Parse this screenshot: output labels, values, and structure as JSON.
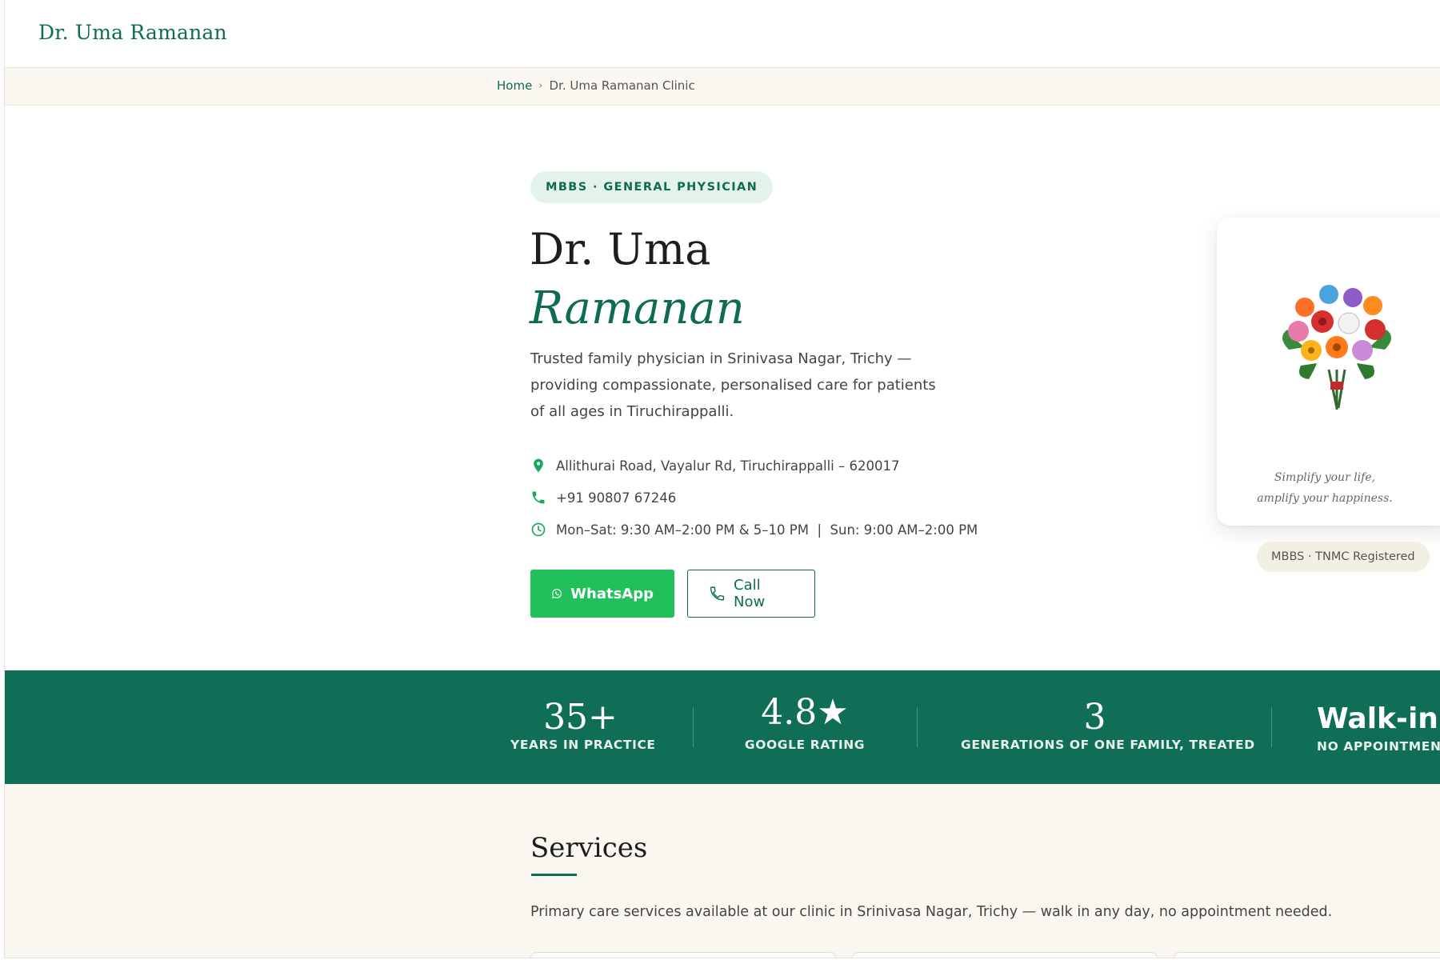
{
  "header": {
    "brand": "Dr. Uma Ramanan"
  },
  "breadcrumb": {
    "home": "Home",
    "separator": "›",
    "current": "Dr. Uma Ramanan Clinic"
  },
  "hero": {
    "badge": "MBBS · GENERAL PHYSICIAN",
    "name_line1": "Dr. Uma",
    "name_line2": "Ramanan",
    "intro": "Trusted family physician in Srinivasa Nagar, Trichy — providing compassionate, personalised care for patients of all ages in Tiruchirappalli.",
    "contacts": {
      "address": {
        "icon": "map-pin-icon",
        "text": "Allithurai Road, Vayalur Rd, Tiruchirappalli – 620017"
      },
      "phone": {
        "icon": "phone-icon",
        "text": "+91 90807 67246"
      },
      "hours": {
        "icon": "clock-icon",
        "text": "Mon–Sat: 9:30 AM–2:00 PM & 5–10 PM  |  Sun: 9:00 AM–2:00 PM"
      }
    },
    "buttons": {
      "whatsapp": "WhatsApp",
      "call": "Call Now"
    },
    "card": {
      "tagline_line1": "Simplify your life,",
      "tagline_line2": "amplify your happiness."
    },
    "registration": "MBBS · TNMC Registered"
  },
  "stats": [
    {
      "value": "35+",
      "label": "YEARS IN PRACTICE"
    },
    {
      "value": "4.8★",
      "label": "GOOGLE RATING"
    },
    {
      "value": "3",
      "label": "GENERATIONS OF ONE FAMILY, TREATED"
    },
    {
      "value": "Walk-in",
      "label": "NO APPOINTMENT NEEDED"
    }
  ],
  "services": {
    "title": "Services",
    "intro": "Primary care services available at our clinic in Srinivasa Nagar, Trichy — walk in any day, no appointment needed."
  },
  "colors": {
    "brand_green": "#0f6b54",
    "band_green": "#116e56",
    "whatsapp_green": "#22c05a",
    "cream": "#faf7f0"
  }
}
